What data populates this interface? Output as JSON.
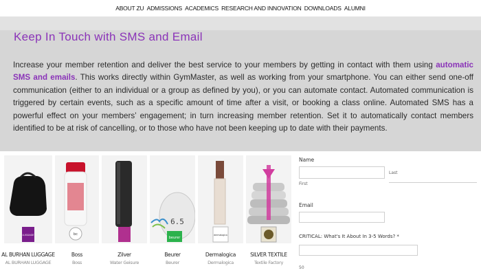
{
  "nav": {
    "items": [
      "ABOUT ZU",
      "ADMISSIONS",
      "ACADEMICS",
      "RESEARCH AND INNOVATION",
      "DOWNLOADS",
      "ALUMNI"
    ]
  },
  "hero": {
    "title": "Keep In Touch with SMS and Email",
    "para_before": "Increase your member retention and deliver the best service to your members by getting in contact with them using ",
    "para_bold": "automatic SMS and emails",
    "para_after": ". This works directly within GymMaster, as well as working from your smartphone. You can either send one-off communication (either to an individual or a group as defined by you), or you can automate contact. Automated communication is triggered by certain events, such as a specific amount of time after a visit, or booking a class online. Automated SMS has a powerful effect on your members’ engagement; in turn increasing member retention. Set it to automatically contact members identified to be at risk of cancelling, or to those who have not been keeping up to date with their payments.",
    "accent_color": "#8a33b8"
  },
  "products": [
    {
      "name": "AL BURHAN LUGGAGE",
      "sub": "AL BURHAN LUGGAGE",
      "logo_color": "#7a1e8c",
      "logo_text": "LUGGAGE"
    },
    {
      "name": "Boss",
      "sub": "Boss",
      "logo_color": "#ffffff",
      "logo_text": "bc"
    },
    {
      "name": "Zilver",
      "sub": "Water Geisure",
      "logo_color": "#b0308f",
      "logo_text": ""
    },
    {
      "name": "Beurer",
      "sub": "Beurer",
      "logo_color": "#2bb24c",
      "logo_text": "beurer"
    },
    {
      "name": "Dermalogica",
      "sub": "Dermalogica",
      "logo_color": "#ffffff",
      "logo_text": "dermalogica"
    },
    {
      "name": "SILVER TEXTILE",
      "sub": "Textile Factory",
      "logo_color": "#6b5a2a",
      "logo_text": ""
    }
  ],
  "form": {
    "name_label": "Name",
    "first_label": "First",
    "last_label": "Last",
    "email_label": "Email",
    "critical_label": "CRITICAL: What's It About In 3-5 Words? *",
    "counter": "50"
  }
}
